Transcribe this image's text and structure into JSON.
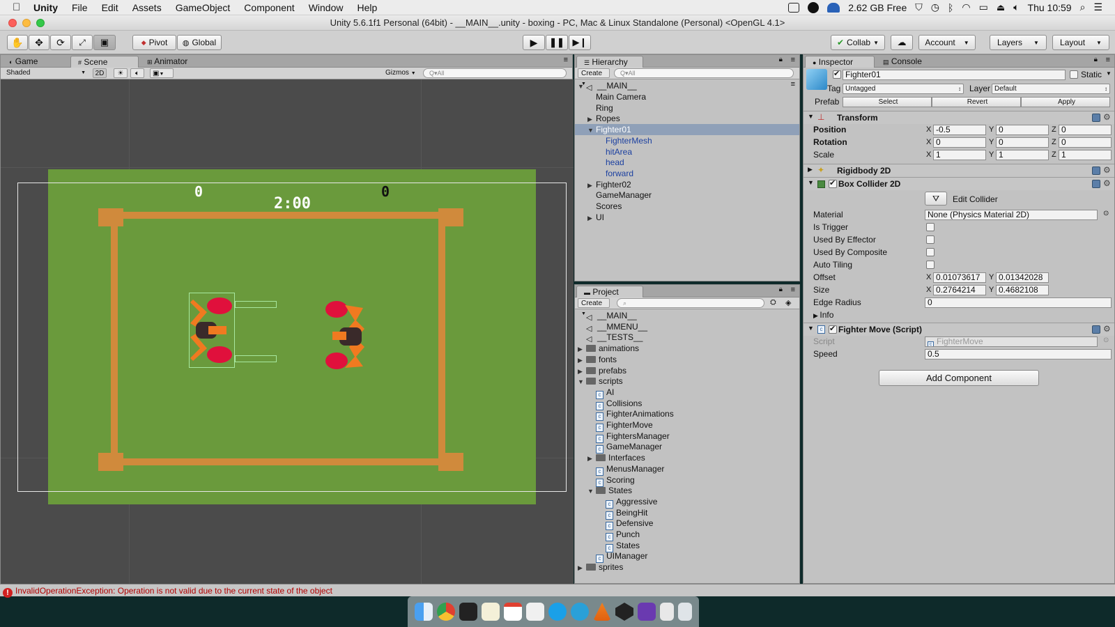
{
  "menubar": {
    "apple": "",
    "items": [
      "Unity",
      "File",
      "Edit",
      "Assets",
      "GameObject",
      "Component",
      "Window",
      "Help"
    ],
    "memory": "2.62 GB Free",
    "clock": "Thu 10:59"
  },
  "window": {
    "title": "Unity 5.6.1f1 Personal (64bit) - __MAIN__.unity - boxing - PC, Mac & Linux Standalone (Personal) <OpenGL 4.1>"
  },
  "toolbar": {
    "pivot": "Pivot",
    "global": "Global",
    "collab": "Collab",
    "account": "Account",
    "layers": "Layers",
    "layout": "Layout"
  },
  "scene": {
    "tabs": [
      "Game",
      "Scene",
      "Animator"
    ],
    "shading": "Shaded",
    "mode2d": "2D",
    "gizmos": "Gizmos",
    "search_placeholder": "Q▾All",
    "score_left": "0",
    "score_right": "0",
    "timer": "2:00",
    "colors": {
      "field": "#6a9a3c",
      "ropes": "#d08a3c",
      "glove": "#e0103c",
      "arm": "#f07a20"
    }
  },
  "hierarchy": {
    "tab": "Hierarchy",
    "create": "Create",
    "search_placeholder": "Q▾All",
    "scene_name": "__MAIN__",
    "items": [
      {
        "label": "Main Camera",
        "depth": 1,
        "arrow": ""
      },
      {
        "label": "Ring",
        "depth": 1,
        "arrow": ""
      },
      {
        "label": "Ropes",
        "depth": 1,
        "arrow": "▶"
      },
      {
        "label": "Fighter01",
        "depth": 1,
        "arrow": "▼"
      },
      {
        "label": "FighterMesh",
        "depth": 2,
        "arrow": ""
      },
      {
        "label": "hitArea",
        "depth": 2,
        "arrow": ""
      },
      {
        "label": "head",
        "depth": 2,
        "arrow": ""
      },
      {
        "label": "forward",
        "depth": 2,
        "arrow": ""
      },
      {
        "label": "Fighter02",
        "depth": 1,
        "arrow": "▶"
      },
      {
        "label": "GameManager",
        "depth": 1,
        "arrow": ""
      },
      {
        "label": "Scores",
        "depth": 1,
        "arrow": ""
      },
      {
        "label": "UI",
        "depth": 1,
        "arrow": "▶"
      }
    ]
  },
  "project": {
    "tab": "Project",
    "create": "Create",
    "items": [
      {
        "label": "__MAIN__",
        "kind": "unity",
        "depth": 0,
        "arrow": ""
      },
      {
        "label": "__MMENU__",
        "kind": "unity",
        "depth": 0,
        "arrow": ""
      },
      {
        "label": "__TESTS__",
        "kind": "unity",
        "depth": 0,
        "arrow": ""
      },
      {
        "label": "animations",
        "kind": "folder",
        "depth": 0,
        "arrow": "▶"
      },
      {
        "label": "fonts",
        "kind": "folder",
        "depth": 0,
        "arrow": "▶"
      },
      {
        "label": "prefabs",
        "kind": "folder",
        "depth": 0,
        "arrow": "▶"
      },
      {
        "label": "scripts",
        "kind": "folder",
        "depth": 0,
        "arrow": "▼"
      },
      {
        "label": "AI",
        "kind": "script",
        "depth": 1,
        "arrow": ""
      },
      {
        "label": "Collisions",
        "kind": "script",
        "depth": 1,
        "arrow": ""
      },
      {
        "label": "FighterAnimations",
        "kind": "script",
        "depth": 1,
        "arrow": ""
      },
      {
        "label": "FighterMove",
        "kind": "script",
        "depth": 1,
        "arrow": ""
      },
      {
        "label": "FightersManager",
        "kind": "script",
        "depth": 1,
        "arrow": ""
      },
      {
        "label": "GameManager",
        "kind": "script",
        "depth": 1,
        "arrow": ""
      },
      {
        "label": "Interfaces",
        "kind": "folder",
        "depth": 1,
        "arrow": "▶"
      },
      {
        "label": "MenusManager",
        "kind": "script",
        "depth": 1,
        "arrow": ""
      },
      {
        "label": "Scoring",
        "kind": "script",
        "depth": 1,
        "arrow": ""
      },
      {
        "label": "States",
        "kind": "folder",
        "depth": 1,
        "arrow": "▼"
      },
      {
        "label": "Aggressive",
        "kind": "script",
        "depth": 2,
        "arrow": ""
      },
      {
        "label": "BeingHit",
        "kind": "script",
        "depth": 2,
        "arrow": ""
      },
      {
        "label": "Defensive",
        "kind": "script",
        "depth": 2,
        "arrow": ""
      },
      {
        "label": "Punch",
        "kind": "script",
        "depth": 2,
        "arrow": ""
      },
      {
        "label": "States",
        "kind": "script",
        "depth": 2,
        "arrow": ""
      },
      {
        "label": "UIManager",
        "kind": "script",
        "depth": 1,
        "arrow": ""
      },
      {
        "label": "sprites",
        "kind": "folder",
        "depth": 0,
        "arrow": "▶"
      }
    ]
  },
  "inspector": {
    "tabs": [
      "Inspector",
      "Console"
    ],
    "object_name": "Fighter01",
    "static_label": "Static",
    "tag_label": "Tag",
    "tag_value": "Untagged",
    "layer_label": "Layer",
    "layer_value": "Default",
    "prefab_label": "Prefab",
    "prefab_buttons": [
      "Select",
      "Revert",
      "Apply"
    ],
    "transform": {
      "title": "Transform",
      "position_label": "Position",
      "position": [
        "-0.5",
        "0",
        "0"
      ],
      "rotation_label": "Rotation",
      "rotation": [
        "0",
        "0",
        "0"
      ],
      "scale_label": "Scale",
      "scale": [
        "1",
        "1",
        "1"
      ]
    },
    "rigidbody_title": "Rigidbody 2D",
    "box_collider": {
      "title": "Box Collider 2D",
      "edit_collider": "Edit Collider",
      "material_label": "Material",
      "material_value": "None (Physics Material 2D)",
      "is_trigger": "Is Trigger",
      "used_by_effector": "Used By Effector",
      "used_by_composite": "Used By Composite",
      "auto_tiling": "Auto Tiling",
      "offset_label": "Offset",
      "offset": [
        "0.01073617",
        "0.01342028"
      ],
      "size_label": "Size",
      "size": [
        "0.2764214",
        "0.4682108"
      ],
      "edge_radius_label": "Edge Radius",
      "edge_radius": "0",
      "info": "Info"
    },
    "fighter_move": {
      "title": "Fighter Move (Script)",
      "script_label": "Script",
      "script_value": "FighterMove",
      "speed_label": "Speed",
      "speed": "0.5"
    },
    "add_component": "Add Component"
  },
  "status": {
    "message": "InvalidOperationException: Operation is not valid due to the current state of the object"
  }
}
